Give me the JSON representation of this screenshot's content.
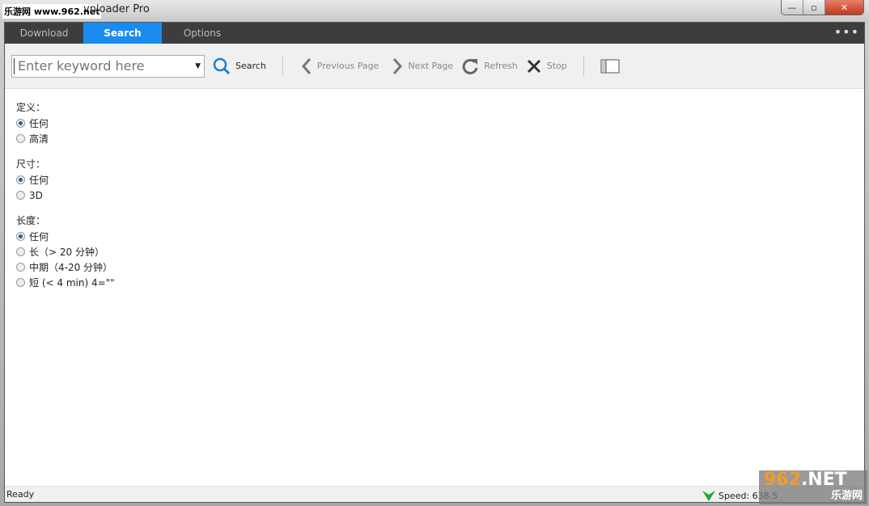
{
  "window": {
    "watermark": "乐游网 www.962.net",
    "title": "vnloader Pro",
    "minimize": "—",
    "maximize": "▫",
    "close": "✕"
  },
  "tabs": [
    {
      "label": "Download"
    },
    {
      "label": "Search",
      "active": true
    },
    {
      "label": "Options"
    }
  ],
  "more": "•••",
  "toolbar": {
    "search_placeholder": "Enter keyword here",
    "search": "Search",
    "previous": "Previous Page",
    "next": "Next Page",
    "refresh": "Refresh",
    "stop": "Stop"
  },
  "filters": [
    {
      "label": "定义：",
      "options": [
        {
          "label": "任何",
          "selected": true
        },
        {
          "label": "高清",
          "selected": false
        }
      ]
    },
    {
      "label": "尺寸：",
      "options": [
        {
          "label": "任何",
          "selected": true
        },
        {
          "label": "3D",
          "selected": false
        }
      ]
    },
    {
      "label": "长度：",
      "options": [
        {
          "label": "任何",
          "selected": true
        },
        {
          "label": "长（> 20 分钟）",
          "selected": false
        },
        {
          "label": "中期（4-20 分钟）",
          "selected": false
        },
        {
          "label": "短 (< 4 min) 4=\"\"",
          "selected": false
        }
      ]
    }
  ],
  "status": {
    "text": "Ready",
    "speed": "Speed: 638.5",
    "speed_color": "#1aa82a"
  },
  "logo": {
    "brand": "962",
    "suffix": ".NET",
    "cn": "乐游网"
  },
  "colors": {
    "accent": "#1a8cf0",
    "tabbar": "#3d3d3d"
  }
}
